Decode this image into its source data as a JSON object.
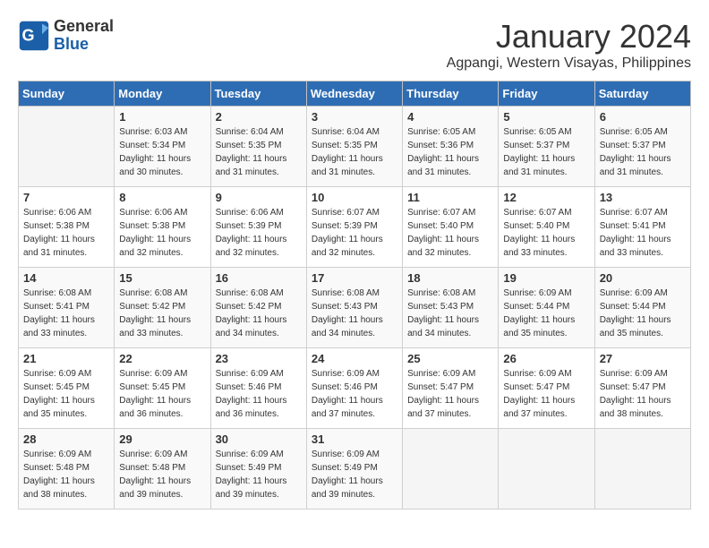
{
  "header": {
    "logo_general": "General",
    "logo_blue": "Blue",
    "month_title": "January 2024",
    "location": "Agpangi, Western Visayas, Philippines"
  },
  "days_of_week": [
    "Sunday",
    "Monday",
    "Tuesday",
    "Wednesday",
    "Thursday",
    "Friday",
    "Saturday"
  ],
  "weeks": [
    [
      {
        "day": "",
        "sunrise": "",
        "sunset": "",
        "daylight": ""
      },
      {
        "day": "1",
        "sunrise": "6:03 AM",
        "sunset": "5:34 PM",
        "daylight": "11 hours and 30 minutes."
      },
      {
        "day": "2",
        "sunrise": "6:04 AM",
        "sunset": "5:35 PM",
        "daylight": "11 hours and 31 minutes."
      },
      {
        "day": "3",
        "sunrise": "6:04 AM",
        "sunset": "5:35 PM",
        "daylight": "11 hours and 31 minutes."
      },
      {
        "day": "4",
        "sunrise": "6:05 AM",
        "sunset": "5:36 PM",
        "daylight": "11 hours and 31 minutes."
      },
      {
        "day": "5",
        "sunrise": "6:05 AM",
        "sunset": "5:37 PM",
        "daylight": "11 hours and 31 minutes."
      },
      {
        "day": "6",
        "sunrise": "6:05 AM",
        "sunset": "5:37 PM",
        "daylight": "11 hours and 31 minutes."
      }
    ],
    [
      {
        "day": "7",
        "sunrise": "6:06 AM",
        "sunset": "5:38 PM",
        "daylight": "11 hours and 31 minutes."
      },
      {
        "day": "8",
        "sunrise": "6:06 AM",
        "sunset": "5:38 PM",
        "daylight": "11 hours and 32 minutes."
      },
      {
        "day": "9",
        "sunrise": "6:06 AM",
        "sunset": "5:39 PM",
        "daylight": "11 hours and 32 minutes."
      },
      {
        "day": "10",
        "sunrise": "6:07 AM",
        "sunset": "5:39 PM",
        "daylight": "11 hours and 32 minutes."
      },
      {
        "day": "11",
        "sunrise": "6:07 AM",
        "sunset": "5:40 PM",
        "daylight": "11 hours and 32 minutes."
      },
      {
        "day": "12",
        "sunrise": "6:07 AM",
        "sunset": "5:40 PM",
        "daylight": "11 hours and 33 minutes."
      },
      {
        "day": "13",
        "sunrise": "6:07 AM",
        "sunset": "5:41 PM",
        "daylight": "11 hours and 33 minutes."
      }
    ],
    [
      {
        "day": "14",
        "sunrise": "6:08 AM",
        "sunset": "5:41 PM",
        "daylight": "11 hours and 33 minutes."
      },
      {
        "day": "15",
        "sunrise": "6:08 AM",
        "sunset": "5:42 PM",
        "daylight": "11 hours and 33 minutes."
      },
      {
        "day": "16",
        "sunrise": "6:08 AM",
        "sunset": "5:42 PM",
        "daylight": "11 hours and 34 minutes."
      },
      {
        "day": "17",
        "sunrise": "6:08 AM",
        "sunset": "5:43 PM",
        "daylight": "11 hours and 34 minutes."
      },
      {
        "day": "18",
        "sunrise": "6:08 AM",
        "sunset": "5:43 PM",
        "daylight": "11 hours and 34 minutes."
      },
      {
        "day": "19",
        "sunrise": "6:09 AM",
        "sunset": "5:44 PM",
        "daylight": "11 hours and 35 minutes."
      },
      {
        "day": "20",
        "sunrise": "6:09 AM",
        "sunset": "5:44 PM",
        "daylight": "11 hours and 35 minutes."
      }
    ],
    [
      {
        "day": "21",
        "sunrise": "6:09 AM",
        "sunset": "5:45 PM",
        "daylight": "11 hours and 35 minutes."
      },
      {
        "day": "22",
        "sunrise": "6:09 AM",
        "sunset": "5:45 PM",
        "daylight": "11 hours and 36 minutes."
      },
      {
        "day": "23",
        "sunrise": "6:09 AM",
        "sunset": "5:46 PM",
        "daylight": "11 hours and 36 minutes."
      },
      {
        "day": "24",
        "sunrise": "6:09 AM",
        "sunset": "5:46 PM",
        "daylight": "11 hours and 37 minutes."
      },
      {
        "day": "25",
        "sunrise": "6:09 AM",
        "sunset": "5:47 PM",
        "daylight": "11 hours and 37 minutes."
      },
      {
        "day": "26",
        "sunrise": "6:09 AM",
        "sunset": "5:47 PM",
        "daylight": "11 hours and 37 minutes."
      },
      {
        "day": "27",
        "sunrise": "6:09 AM",
        "sunset": "5:47 PM",
        "daylight": "11 hours and 38 minutes."
      }
    ],
    [
      {
        "day": "28",
        "sunrise": "6:09 AM",
        "sunset": "5:48 PM",
        "daylight": "11 hours and 38 minutes."
      },
      {
        "day": "29",
        "sunrise": "6:09 AM",
        "sunset": "5:48 PM",
        "daylight": "11 hours and 39 minutes."
      },
      {
        "day": "30",
        "sunrise": "6:09 AM",
        "sunset": "5:49 PM",
        "daylight": "11 hours and 39 minutes."
      },
      {
        "day": "31",
        "sunrise": "6:09 AM",
        "sunset": "5:49 PM",
        "daylight": "11 hours and 39 minutes."
      },
      {
        "day": "",
        "sunrise": "",
        "sunset": "",
        "daylight": ""
      },
      {
        "day": "",
        "sunrise": "",
        "sunset": "",
        "daylight": ""
      },
      {
        "day": "",
        "sunrise": "",
        "sunset": "",
        "daylight": ""
      }
    ]
  ],
  "labels": {
    "sunrise_prefix": "Sunrise: ",
    "sunset_prefix": "Sunset: ",
    "daylight_prefix": "Daylight: "
  }
}
